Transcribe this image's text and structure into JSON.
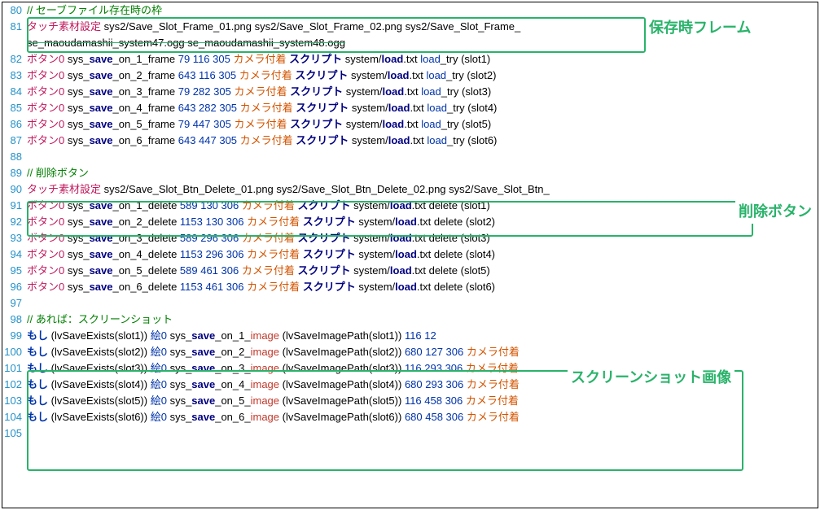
{
  "callouts": {
    "box1": "保存時フレーム",
    "box2": "削除ボタン",
    "box3": "スクリーンショット画像"
  },
  "lines": [
    {
      "num": 80,
      "tokens": [
        [
          "c-green",
          "// セーブファイル存在時の枠"
        ]
      ]
    },
    {
      "num": 81,
      "tokens": [
        [
          "c-magenta",
          "タッチ素材設定"
        ],
        [
          "c-black",
          " sys2/Save_Slot_Frame_01.png sys2/Save_Slot_Frame_02.png sys2/Save_Slot_Frame_"
        ]
      ],
      "strike_tokens": [
        [
          "c-black",
          "se_maoudamashii_system47.ogg se_maoudamashii_system48.ogg"
        ]
      ]
    },
    {
      "num": 82,
      "tokens": [
        [
          "c-magenta",
          "ボタン0"
        ],
        [
          "c-black",
          " sys_"
        ],
        [
          "c-navy",
          "save"
        ],
        [
          "c-black",
          "_on_1_frame "
        ],
        [
          "c-blue",
          "79 116 305"
        ],
        [
          "c-black",
          " "
        ],
        [
          "c-orange",
          "カメラ付着"
        ],
        [
          "c-black",
          " "
        ],
        [
          "c-navy c-bold",
          "スクリプト"
        ],
        [
          "c-black",
          " system/"
        ],
        [
          "c-navy",
          "load"
        ],
        [
          "c-black",
          ".txt "
        ],
        [
          "c-blue",
          "load"
        ],
        [
          "c-black",
          "_try (slot1)"
        ]
      ]
    },
    {
      "num": 83,
      "tokens": [
        [
          "c-magenta",
          "ボタン0"
        ],
        [
          "c-black",
          " sys_"
        ],
        [
          "c-navy",
          "save"
        ],
        [
          "c-black",
          "_on_2_frame "
        ],
        [
          "c-blue",
          "643 116 305"
        ],
        [
          "c-black",
          " "
        ],
        [
          "c-orange",
          "カメラ付着"
        ],
        [
          "c-black",
          " "
        ],
        [
          "c-navy c-bold",
          "スクリプト"
        ],
        [
          "c-black",
          " system/"
        ],
        [
          "c-navy",
          "load"
        ],
        [
          "c-black",
          ".txt "
        ],
        [
          "c-blue",
          "load"
        ],
        [
          "c-black",
          "_try (slot2)"
        ]
      ]
    },
    {
      "num": 84,
      "tokens": [
        [
          "c-magenta",
          "ボタン0"
        ],
        [
          "c-black",
          " sys_"
        ],
        [
          "c-navy",
          "save"
        ],
        [
          "c-black",
          "_on_3_frame "
        ],
        [
          "c-blue",
          "79 282 305"
        ],
        [
          "c-black",
          " "
        ],
        [
          "c-orange",
          "カメラ付着"
        ],
        [
          "c-black",
          " "
        ],
        [
          "c-navy c-bold",
          "スクリプト"
        ],
        [
          "c-black",
          " system/"
        ],
        [
          "c-navy",
          "load"
        ],
        [
          "c-black",
          ".txt "
        ],
        [
          "c-blue",
          "load"
        ],
        [
          "c-black",
          "_try (slot3)"
        ]
      ]
    },
    {
      "num": 85,
      "tokens": [
        [
          "c-magenta",
          "ボタン0"
        ],
        [
          "c-black",
          " sys_"
        ],
        [
          "c-navy",
          "save"
        ],
        [
          "c-black",
          "_on_4_frame "
        ],
        [
          "c-blue",
          "643 282 305"
        ],
        [
          "c-black",
          " "
        ],
        [
          "c-orange",
          "カメラ付着"
        ],
        [
          "c-black",
          " "
        ],
        [
          "c-navy c-bold",
          "スクリプト"
        ],
        [
          "c-black",
          " system/"
        ],
        [
          "c-navy",
          "load"
        ],
        [
          "c-black",
          ".txt "
        ],
        [
          "c-blue",
          "load"
        ],
        [
          "c-black",
          "_try (slot4)"
        ]
      ]
    },
    {
      "num": 86,
      "tokens": [
        [
          "c-magenta",
          "ボタン0"
        ],
        [
          "c-black",
          " sys_"
        ],
        [
          "c-navy",
          "save"
        ],
        [
          "c-black",
          "_on_5_frame "
        ],
        [
          "c-blue",
          "79 447 305"
        ],
        [
          "c-black",
          " "
        ],
        [
          "c-orange",
          "カメラ付着"
        ],
        [
          "c-black",
          " "
        ],
        [
          "c-navy c-bold",
          "スクリプト"
        ],
        [
          "c-black",
          " system/"
        ],
        [
          "c-navy",
          "load"
        ],
        [
          "c-black",
          ".txt "
        ],
        [
          "c-blue",
          "load"
        ],
        [
          "c-black",
          "_try (slot5)"
        ]
      ]
    },
    {
      "num": 87,
      "tokens": [
        [
          "c-magenta",
          "ボタン0"
        ],
        [
          "c-black",
          " sys_"
        ],
        [
          "c-navy",
          "save"
        ],
        [
          "c-black",
          "_on_6_frame "
        ],
        [
          "c-blue",
          "643 447 305"
        ],
        [
          "c-black",
          " "
        ],
        [
          "c-orange",
          "カメラ付着"
        ],
        [
          "c-black",
          " "
        ],
        [
          "c-navy c-bold",
          "スクリプト"
        ],
        [
          "c-black",
          " system/"
        ],
        [
          "c-navy",
          "load"
        ],
        [
          "c-black",
          ".txt "
        ],
        [
          "c-blue",
          "load"
        ],
        [
          "c-black",
          "_try (slot6)"
        ]
      ]
    },
    {
      "num": 88,
      "tokens": []
    },
    {
      "num": 89,
      "tokens": [
        [
          "c-green",
          "// 削除ボタン"
        ]
      ]
    },
    {
      "num": 90,
      "tokens": [
        [
          "c-magenta",
          "タッチ素材設定"
        ],
        [
          "c-black",
          " sys2/Save_Slot_Btn_Delete_01.png sys2/Save_Slot_Btn_Delete_02.png sys2/Save_Slot_Btn_"
        ]
      ]
    },
    {
      "num": 91,
      "tokens": [
        [
          "c-magenta",
          "ボタン0"
        ],
        [
          "c-black",
          " sys_"
        ],
        [
          "c-navy",
          "save"
        ],
        [
          "c-black",
          "_on_1_delete "
        ],
        [
          "c-blue",
          "589 130 306"
        ],
        [
          "c-black",
          " "
        ],
        [
          "c-orange",
          "カメラ付着"
        ],
        [
          "c-black",
          " "
        ],
        [
          "c-navy c-bold",
          "スクリプト"
        ],
        [
          "c-black",
          " system/"
        ],
        [
          "c-navy",
          "load"
        ],
        [
          "c-black",
          ".txt delete (slot1)"
        ]
      ]
    },
    {
      "num": 92,
      "tokens": [
        [
          "c-magenta",
          "ボタン0"
        ],
        [
          "c-black",
          " sys_"
        ],
        [
          "c-navy",
          "save"
        ],
        [
          "c-black",
          "_on_2_delete "
        ],
        [
          "c-blue",
          "1153 130 306"
        ],
        [
          "c-black",
          " "
        ],
        [
          "c-orange",
          "カメラ付着"
        ],
        [
          "c-black",
          " "
        ],
        [
          "c-navy c-bold",
          "スクリプト"
        ],
        [
          "c-black",
          " system/"
        ],
        [
          "c-navy",
          "load"
        ],
        [
          "c-black",
          ".txt delete (slot2)"
        ]
      ]
    },
    {
      "num": 93,
      "tokens": [
        [
          "c-magenta",
          "ボタン0"
        ],
        [
          "c-black",
          " sys_"
        ],
        [
          "c-navy",
          "save"
        ],
        [
          "c-black",
          "_on_3_delete "
        ],
        [
          "c-blue",
          "589 296 306"
        ],
        [
          "c-black",
          " "
        ],
        [
          "c-orange",
          "カメラ付着"
        ],
        [
          "c-black",
          " "
        ],
        [
          "c-navy c-bold",
          "スクリプト"
        ],
        [
          "c-black",
          " system/"
        ],
        [
          "c-navy",
          "load"
        ],
        [
          "c-black",
          ".txt delete (slot3)"
        ]
      ]
    },
    {
      "num": 94,
      "tokens": [
        [
          "c-magenta",
          "ボタン0"
        ],
        [
          "c-black",
          " sys_"
        ],
        [
          "c-navy",
          "save"
        ],
        [
          "c-black",
          "_on_4_delete "
        ],
        [
          "c-blue",
          "1153 296 306"
        ],
        [
          "c-black",
          " "
        ],
        [
          "c-orange",
          "カメラ付着"
        ],
        [
          "c-black",
          " "
        ],
        [
          "c-navy c-bold",
          "スクリプト"
        ],
        [
          "c-black",
          " system/"
        ],
        [
          "c-navy",
          "load"
        ],
        [
          "c-black",
          ".txt delete (slot4)"
        ]
      ]
    },
    {
      "num": 95,
      "tokens": [
        [
          "c-magenta",
          "ボタン0"
        ],
        [
          "c-black",
          " sys_"
        ],
        [
          "c-navy",
          "save"
        ],
        [
          "c-black",
          "_on_5_delete "
        ],
        [
          "c-blue",
          "589 461 306"
        ],
        [
          "c-black",
          " "
        ],
        [
          "c-orange",
          "カメラ付着"
        ],
        [
          "c-black",
          " "
        ],
        [
          "c-navy c-bold",
          "スクリプト"
        ],
        [
          "c-black",
          " system/"
        ],
        [
          "c-navy",
          "load"
        ],
        [
          "c-black",
          ".txt delete (slot5)"
        ]
      ]
    },
    {
      "num": 96,
      "tokens": [
        [
          "c-magenta",
          "ボタン0"
        ],
        [
          "c-black",
          " sys_"
        ],
        [
          "c-navy",
          "save"
        ],
        [
          "c-black",
          "_on_6_delete "
        ],
        [
          "c-blue",
          "1153 461 306"
        ],
        [
          "c-black",
          " "
        ],
        [
          "c-orange",
          "カメラ付着"
        ],
        [
          "c-black",
          " "
        ],
        [
          "c-navy c-bold",
          "スクリプト"
        ],
        [
          "c-black",
          " system/"
        ],
        [
          "c-navy",
          "load"
        ],
        [
          "c-black",
          ".txt delete (slot6)"
        ]
      ]
    },
    {
      "num": 97,
      "tokens": []
    },
    {
      "num": 98,
      "tokens": [
        [
          "c-green",
          "// あれば：スクリーンショット"
        ]
      ]
    },
    {
      "num": 99,
      "tokens": [
        [
          "c-blue2",
          "もし"
        ],
        [
          "c-black",
          " (lvSaveExists(slot1)) "
        ],
        [
          "c-blue",
          "絵0"
        ],
        [
          "c-black",
          " sys_"
        ],
        [
          "c-navy",
          "save"
        ],
        [
          "c-black",
          "_on_1_"
        ],
        [
          "c-red",
          "image"
        ],
        [
          "c-black",
          " (lvSaveImagePath(slot1)) "
        ],
        [
          "c-blue",
          "116 12"
        ]
      ]
    },
    {
      "num": 100,
      "tokens": [
        [
          "c-blue2",
          "もし"
        ],
        [
          "c-black",
          " (lvSaveExists(slot2)) "
        ],
        [
          "c-blue",
          "絵0"
        ],
        [
          "c-black",
          " sys_"
        ],
        [
          "c-navy",
          "save"
        ],
        [
          "c-black",
          "_on_2_"
        ],
        [
          "c-red",
          "image"
        ],
        [
          "c-black",
          " (lvSaveImagePath(slot2)) "
        ],
        [
          "c-blue",
          "680 127 306"
        ],
        [
          "c-black",
          " "
        ],
        [
          "c-orange",
          "カメラ付着"
        ]
      ]
    },
    {
      "num": 101,
      "tokens": [
        [
          "c-blue2",
          "もし"
        ],
        [
          "c-black",
          " (lvSaveExists(slot3)) "
        ],
        [
          "c-blue",
          "絵0"
        ],
        [
          "c-black",
          " sys_"
        ],
        [
          "c-navy",
          "save"
        ],
        [
          "c-black",
          "_on_3_"
        ],
        [
          "c-red",
          "image"
        ],
        [
          "c-black",
          " (lvSaveImagePath(slot3)) "
        ],
        [
          "c-blue",
          "116 293 306"
        ],
        [
          "c-black",
          " "
        ],
        [
          "c-orange",
          "カメラ付着"
        ]
      ]
    },
    {
      "num": 102,
      "tokens": [
        [
          "c-blue2",
          "もし"
        ],
        [
          "c-black",
          " (lvSaveExists(slot4)) "
        ],
        [
          "c-blue",
          "絵0"
        ],
        [
          "c-black",
          " sys_"
        ],
        [
          "c-navy",
          "save"
        ],
        [
          "c-black",
          "_on_4_"
        ],
        [
          "c-red",
          "image"
        ],
        [
          "c-black",
          " (lvSaveImagePath(slot4)) "
        ],
        [
          "c-blue",
          "680 293 306"
        ],
        [
          "c-black",
          " "
        ],
        [
          "c-orange",
          "カメラ付着"
        ]
      ]
    },
    {
      "num": 103,
      "tokens": [
        [
          "c-blue2",
          "もし"
        ],
        [
          "c-black",
          " (lvSaveExists(slot5)) "
        ],
        [
          "c-blue",
          "絵0"
        ],
        [
          "c-black",
          " sys_"
        ],
        [
          "c-navy",
          "save"
        ],
        [
          "c-black",
          "_on_5_"
        ],
        [
          "c-red",
          "image"
        ],
        [
          "c-black",
          " (lvSaveImagePath(slot5)) "
        ],
        [
          "c-blue",
          "116 458 306"
        ],
        [
          "c-black",
          " "
        ],
        [
          "c-orange",
          "カメラ付着"
        ]
      ]
    },
    {
      "num": 104,
      "tokens": [
        [
          "c-blue2",
          "もし"
        ],
        [
          "c-black",
          " (lvSaveExists(slot6)) "
        ],
        [
          "c-blue",
          "絵0"
        ],
        [
          "c-black",
          " sys_"
        ],
        [
          "c-navy",
          "save"
        ],
        [
          "c-black",
          "_on_6_"
        ],
        [
          "c-red",
          "image"
        ],
        [
          "c-black",
          " (lvSaveImagePath(slot6)) "
        ],
        [
          "c-blue",
          "680 458 306"
        ],
        [
          "c-black",
          " "
        ],
        [
          "c-orange",
          "カメラ付着"
        ]
      ]
    },
    {
      "num": 105,
      "tokens": []
    }
  ]
}
